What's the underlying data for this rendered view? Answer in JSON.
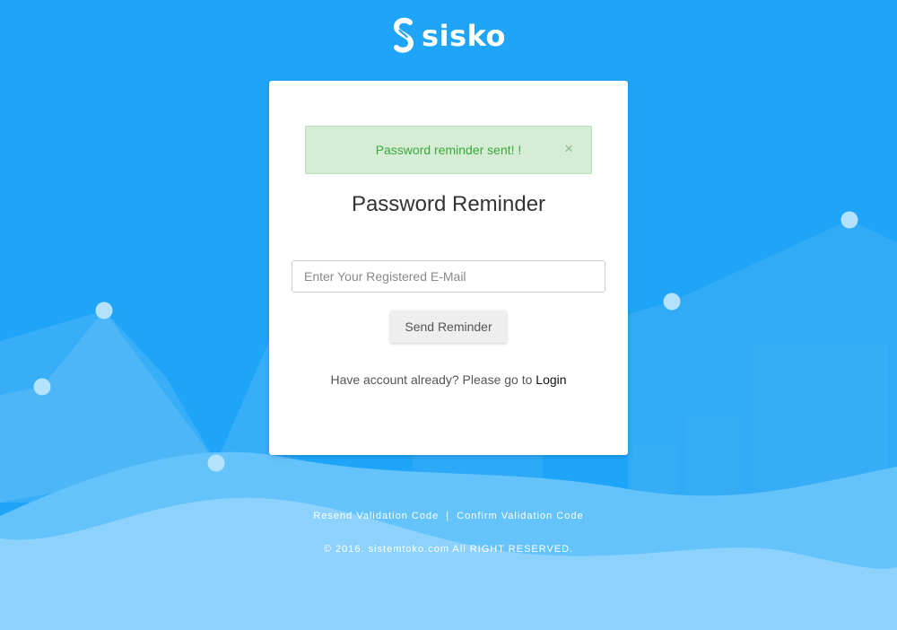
{
  "brand": {
    "name": "sisko"
  },
  "colors": {
    "background": "#1ea5f8",
    "alert_bg": "#d4edd4",
    "alert_text": "#3da83d"
  },
  "alert": {
    "message": "Password reminder sent! !",
    "close": "×"
  },
  "form": {
    "title": "Password Reminder",
    "email_placeholder": "Enter Your Registered E-Mail",
    "email_value": "",
    "submit_label": "Send Reminder",
    "login_prompt": "Have account already? Please go to",
    "login_link": "Login"
  },
  "footer": {
    "resend_link": "Resend Validation Code",
    "separator": "|",
    "confirm_link": "Confirm Validation Code",
    "copyright": "© 2016. sistemtoko.com All RIGHT RESERVED."
  }
}
